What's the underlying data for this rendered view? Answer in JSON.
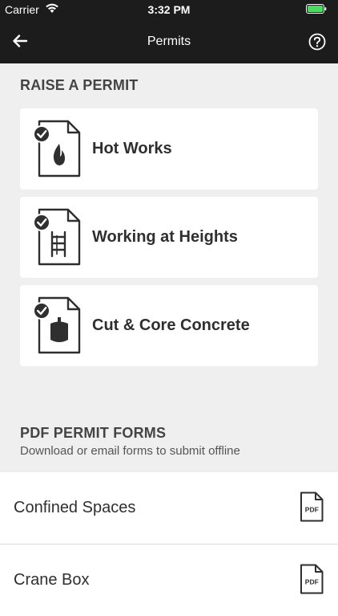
{
  "status_bar": {
    "carrier": "Carrier",
    "time": "3:32 PM"
  },
  "nav": {
    "title": "Permits"
  },
  "raise_section": {
    "title": "RAISE A PERMIT",
    "cards": [
      {
        "label": "Hot Works",
        "icon": "hot-works-icon"
      },
      {
        "label": "Working at Heights",
        "icon": "ladder-icon"
      },
      {
        "label": "Cut & Core Concrete",
        "icon": "concrete-icon"
      }
    ]
  },
  "pdf_section": {
    "title": "PDF PERMIT FORMS",
    "subtitle": "Download or email forms to submit offline",
    "forms": [
      {
        "label": "Confined Spaces",
        "icon_text": "PDF"
      },
      {
        "label": "Crane Box",
        "icon_text": "PDF"
      }
    ]
  }
}
